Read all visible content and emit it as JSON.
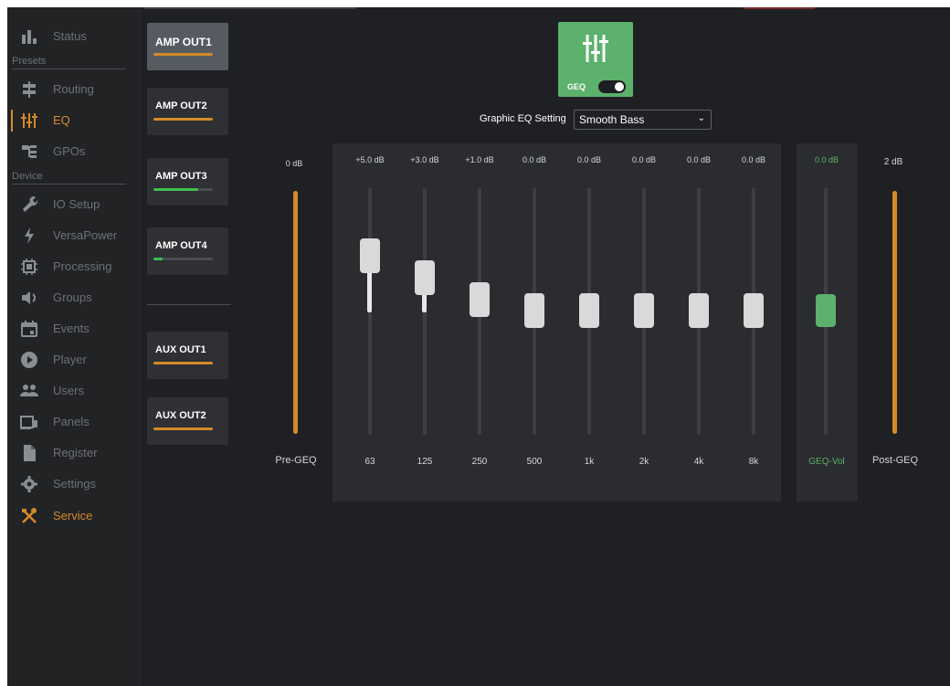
{
  "sidebar": {
    "items": [
      {
        "label": "Status",
        "icon": "bar-chart-icon"
      },
      {
        "label": "Routing",
        "icon": "routing-icon"
      },
      {
        "label": "EQ",
        "icon": "equalizer-icon"
      },
      {
        "label": "GPOs",
        "icon": "gpo-icon"
      },
      {
        "label": "IO Setup",
        "icon": "wrench-icon"
      },
      {
        "label": "VersaPower",
        "icon": "lightning-icon"
      },
      {
        "label": "Processing",
        "icon": "chip-icon"
      },
      {
        "label": "Groups",
        "icon": "speaker-icon"
      },
      {
        "label": "Events",
        "icon": "calendar-icon"
      },
      {
        "label": "Player",
        "icon": "play-icon"
      },
      {
        "label": "Users",
        "icon": "users-icon"
      },
      {
        "label": "Panels",
        "icon": "panels-icon"
      },
      {
        "label": "Register",
        "icon": "document-icon"
      },
      {
        "label": "Settings",
        "icon": "gear-icon"
      },
      {
        "label": "Service",
        "icon": "tools-icon"
      }
    ],
    "section_presets": "Presets",
    "section_device": "Device"
  },
  "channels": [
    {
      "label": "AMP OUT1",
      "meter": 1.0,
      "color": "#d48a2a"
    },
    {
      "label": "AMP OUT2",
      "meter": 1.0,
      "color": "#d48a2a"
    },
    {
      "label": "AMP OUT3",
      "meter": 0.75,
      "color": "#3fbf4f"
    },
    {
      "label": "AMP OUT4",
      "meter": 0.15,
      "color": "#3fbf4f"
    },
    {
      "label": "AUX OUT1",
      "meter": 1.0,
      "color": "#d48a2a"
    },
    {
      "label": "AUX OUT2",
      "meter": 1.0,
      "color": "#d48a2a"
    }
  ],
  "geq": {
    "toggle_label": "GEQ",
    "enabled": true,
    "preset_label": "Graphic EQ Setting",
    "preset_value": "Smooth Bass"
  },
  "pre_geq": {
    "value": "0 dB",
    "label": "Pre-GEQ"
  },
  "post_geq": {
    "value": "2 dB",
    "label": "Post-GEQ"
  },
  "bands": [
    {
      "freq": "63",
      "gain_label": "+5.0 dB",
      "gain": 5.0
    },
    {
      "freq": "125",
      "gain_label": "+3.0 dB",
      "gain": 3.0
    },
    {
      "freq": "250",
      "gain_label": "+1.0 dB",
      "gain": 1.0
    },
    {
      "freq": "500",
      "gain_label": "0.0 dB",
      "gain": 0.0
    },
    {
      "freq": "1k",
      "gain_label": "0.0 dB",
      "gain": 0.0
    },
    {
      "freq": "2k",
      "gain_label": "0.0 dB",
      "gain": 0.0
    },
    {
      "freq": "4k",
      "gain_label": "0.0 dB",
      "gain": 0.0
    },
    {
      "freq": "8k",
      "gain_label": "0.0 dB",
      "gain": 0.0
    }
  ],
  "geq_vol": {
    "value": "0.0 dB",
    "label": "GEQ-Vol",
    "color": "#5cb16c"
  },
  "colors": {
    "accent": "#d48a2a",
    "green": "#5cb16c"
  }
}
